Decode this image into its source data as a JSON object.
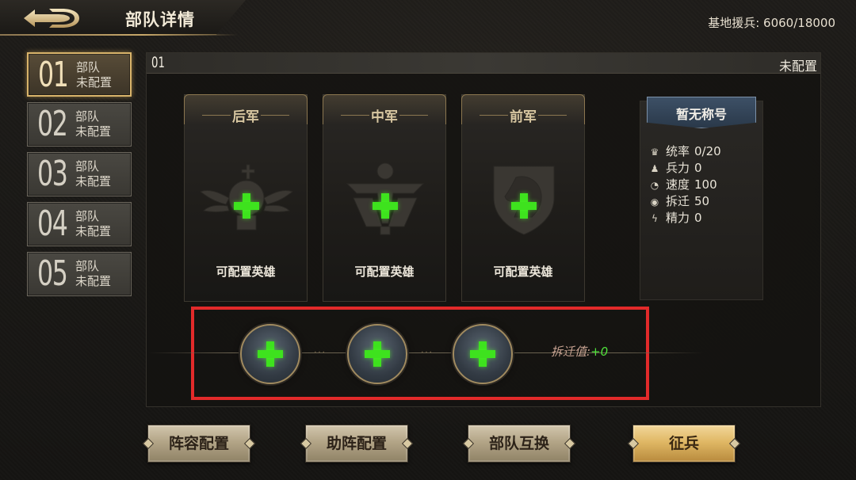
{
  "header": {
    "title": "部队详情",
    "reserve_label": "基地援兵:",
    "reserve_value": "6060/18000",
    "back_icon": "back-arrow-icon"
  },
  "squads": [
    {
      "num": "01",
      "name": "部队",
      "status": "未配置",
      "active": true
    },
    {
      "num": "02",
      "name": "部队",
      "status": "未配置",
      "active": false
    },
    {
      "num": "03",
      "name": "部队",
      "status": "未配置",
      "active": false
    },
    {
      "num": "04",
      "name": "部队",
      "status": "未配置",
      "active": false
    },
    {
      "num": "05",
      "name": "部队",
      "status": "未配置",
      "active": false
    }
  ],
  "panel": {
    "id": "01",
    "status": "未配置"
  },
  "slots": [
    {
      "title": "后军",
      "caption": "可配置英雄",
      "emblem": "winged-chess-king-icon"
    },
    {
      "title": "中军",
      "caption": "可配置英雄",
      "emblem": "sword-chalice-icon"
    },
    {
      "title": "前军",
      "caption": "可配置英雄",
      "emblem": "chess-knight-shield-icon"
    }
  ],
  "stats": {
    "badge": "暂无称号",
    "rows": [
      {
        "icon": "crown-icon",
        "label": "统率",
        "value": "0/20"
      },
      {
        "icon": "soldier-icon",
        "label": "兵力",
        "value": "0"
      },
      {
        "icon": "speedometer-icon",
        "label": "速度",
        "value": "100"
      },
      {
        "icon": "eye-icon",
        "label": "拆迁",
        "value": "50"
      },
      {
        "icon": "lightning-icon",
        "label": "精力",
        "value": "0"
      }
    ]
  },
  "assist": {
    "value_label": "拆迁值:",
    "value": "+0",
    "slot_icon": "plus-icon"
  },
  "buttons": {
    "formation": "阵容配置",
    "assist_formation": "助阵配置",
    "swap": "部队互换",
    "recruit": "征兵"
  },
  "colors": {
    "accent_gold": "#d8b36a",
    "plus_green": "#3ee21e",
    "highlight_red": "#e22a2a",
    "badge_blue": "#3d5066"
  }
}
